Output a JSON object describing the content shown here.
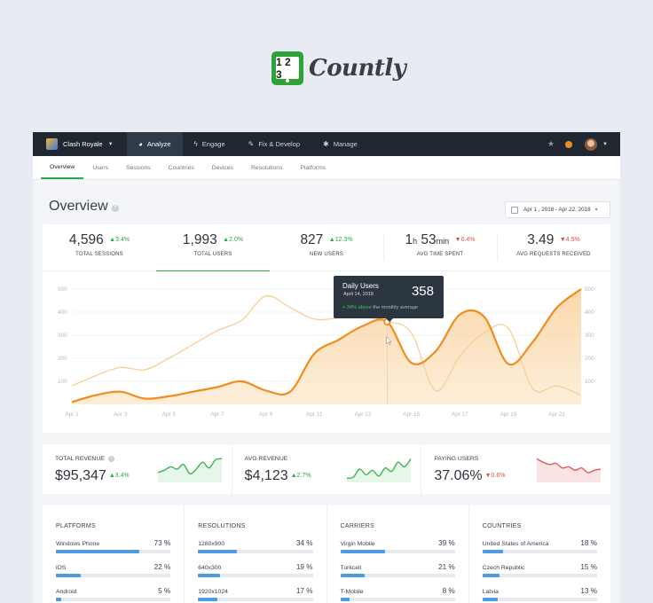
{
  "brand": {
    "name": "Countly",
    "logo_text": "1 2 3",
    "color": "#2fa33a"
  },
  "topnav": {
    "app_name": "Clash Royale",
    "items": [
      {
        "label": "Analyze",
        "icon": "pie-chart-icon",
        "active": true
      },
      {
        "label": "Engage",
        "icon": "bolt-icon",
        "active": false
      },
      {
        "label": "Fix & Develop",
        "icon": "wrench-icon",
        "active": false
      },
      {
        "label": "Manage",
        "icon": "gear-icon",
        "active": false
      }
    ]
  },
  "subnav": {
    "tabs": [
      "Overview",
      "Users",
      "Sessions",
      "Countries",
      "Devices",
      "Resolutions",
      "Platforms"
    ],
    "active": "Overview"
  },
  "page": {
    "title": "Overview",
    "date_range": "Apr 1 , 2018 - Apr 22, 2018"
  },
  "kpis": [
    {
      "value": "4,596",
      "change": "3.4%",
      "direction": "up",
      "label": "TOTAL SESSIONS"
    },
    {
      "value": "1,993",
      "change": "2.0%",
      "direction": "up",
      "label": "TOTAL USERS"
    },
    {
      "value": "827",
      "change": "12.3%",
      "direction": "up",
      "label": "NEW USERS"
    },
    {
      "value_h": "1",
      "unit_h": "h",
      "value_m": "53",
      "unit_m": "min",
      "change": "0.4%",
      "direction": "down",
      "label": "AVG TIME SPENT"
    },
    {
      "value": "3.49",
      "change": "4.5%",
      "direction": "down",
      "label": "AVG REQUESTS RECEIVED"
    }
  ],
  "tooltip": {
    "title": "Daily Users",
    "date": "April 14, 2018",
    "value": "358",
    "note_highlight": "+ 34% above",
    "note_rest": "the monthly average"
  },
  "chart_data": {
    "type": "line",
    "x": [
      "Apr 1",
      "Apr 2",
      "Apr 3",
      "Apr 4",
      "Apr 5",
      "Apr 6",
      "Apr 7",
      "Apr 8",
      "Apr 9",
      "Apr 10",
      "Apr 11",
      "Apr 12",
      "Apr 13",
      "Apr 14",
      "Apr 15",
      "Apr 16",
      "Apr 17",
      "Apr 18",
      "Apr 19",
      "Apr 20",
      "Apr 21",
      "Apr 22"
    ],
    "x_tick_labels": [
      "Apr 1",
      "Apr 3",
      "Apr 5",
      "Apr 7",
      "Apr 9",
      "Apr 11",
      "Apr 13",
      "Apr 15",
      "Apr 17",
      "Apr 19",
      "Apr 21"
    ],
    "y_ticks": [
      100,
      200,
      300,
      400,
      500
    ],
    "ylim": [
      0,
      500
    ],
    "series": [
      {
        "name": "Daily Users",
        "values": [
          10,
          40,
          55,
          25,
          35,
          55,
          75,
          100,
          60,
          55,
          220,
          280,
          340,
          358,
          180,
          230,
          390,
          380,
          175,
          270,
          420,
          500
        ],
        "color": "#f28c1c"
      },
      {
        "name": "",
        "values": [
          80,
          125,
          160,
          150,
          200,
          260,
          320,
          365,
          470,
          420,
          370,
          375,
          380,
          360,
          310,
          60,
          210,
          310,
          330,
          70,
          80,
          40
        ],
        "color": "#f8cf95"
      }
    ],
    "highlight_index": 13
  },
  "revenue": [
    {
      "label": "TOTAL REVENUE",
      "value": "$95,347",
      "change": "3.4%",
      "direction": "up",
      "has_help": true,
      "spark": [
        0.35,
        0.45,
        0.6,
        0.5,
        0.7,
        0.3,
        0.5,
        0.8,
        0.55,
        0.9,
        0.95
      ],
      "color": "#3cb553"
    },
    {
      "label": "AVG REVENUE",
      "value": "$4,123",
      "change": "2.7%",
      "direction": "up",
      "has_help": false,
      "spark": [
        0.1,
        0.15,
        0.5,
        0.25,
        0.45,
        0.2,
        0.55,
        0.4,
        0.8,
        0.6,
        0.95
      ],
      "color": "#3cb553"
    },
    {
      "label": "PAYING USERS",
      "value": "37.06%",
      "change": "0.6%",
      "direction": "down",
      "has_help": false,
      "spark": [
        0.95,
        0.8,
        0.7,
        0.75,
        0.55,
        0.6,
        0.45,
        0.55,
        0.35,
        0.45,
        0.5
      ],
      "color": "#e05a5a"
    }
  ],
  "lists": [
    {
      "title": "PLATFORMS",
      "rows": [
        {
          "name": "Windows Phone",
          "pct": "73 %",
          "value": 73
        },
        {
          "name": "iOS",
          "pct": "22 %",
          "value": 22
        },
        {
          "name": "Android",
          "pct": "5 %",
          "value": 5
        }
      ]
    },
    {
      "title": "RESOLUTIONS",
      "rows": [
        {
          "name": "1280x900",
          "pct": "34 %",
          "value": 34
        },
        {
          "name": "640x300",
          "pct": "19 %",
          "value": 19
        },
        {
          "name": "1920x1024",
          "pct": "17 %",
          "value": 17
        }
      ]
    },
    {
      "title": "CARRIERS",
      "rows": [
        {
          "name": "Virgin Mobile",
          "pct": "39 %",
          "value": 39
        },
        {
          "name": "Turkcell",
          "pct": "21 %",
          "value": 21
        },
        {
          "name": "T-Mobile",
          "pct": "8 %",
          "value": 8
        }
      ]
    },
    {
      "title": "COUNTRIES",
      "rows": [
        {
          "name": "United States of America",
          "pct": "18 %",
          "value": 18
        },
        {
          "name": "Czech Republic",
          "pct": "15 %",
          "value": 15
        },
        {
          "name": "Latvia",
          "pct": "13 %",
          "value": 13
        }
      ]
    }
  ]
}
